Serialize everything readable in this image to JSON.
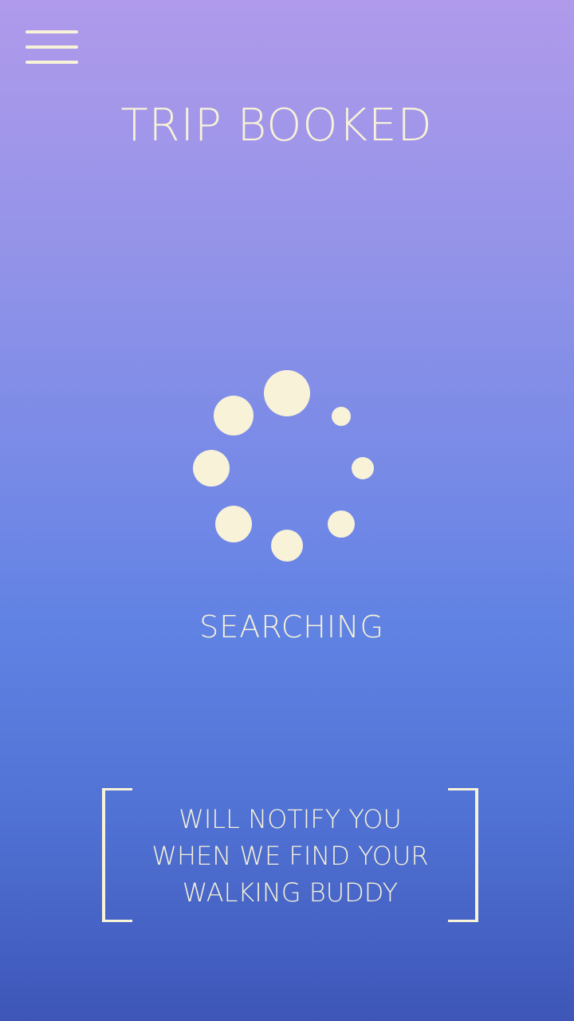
{
  "header": {
    "menu_icon": "hamburger-menu-icon",
    "title": "TRIP BOOKED"
  },
  "status": {
    "spinner_icon": "loading-dots-spinner-icon",
    "label": "SEARCHING"
  },
  "notice": {
    "lines": [
      "WILL NOTIFY YOU",
      "WHEN WE FIND YOUR",
      "WALKING BUDDY"
    ]
  },
  "colors": {
    "text": "#f8f2d8",
    "gradient_top": "#b09aeb",
    "gradient_mid": "#5f82e3",
    "gradient_bottom": "#3d56b8"
  }
}
